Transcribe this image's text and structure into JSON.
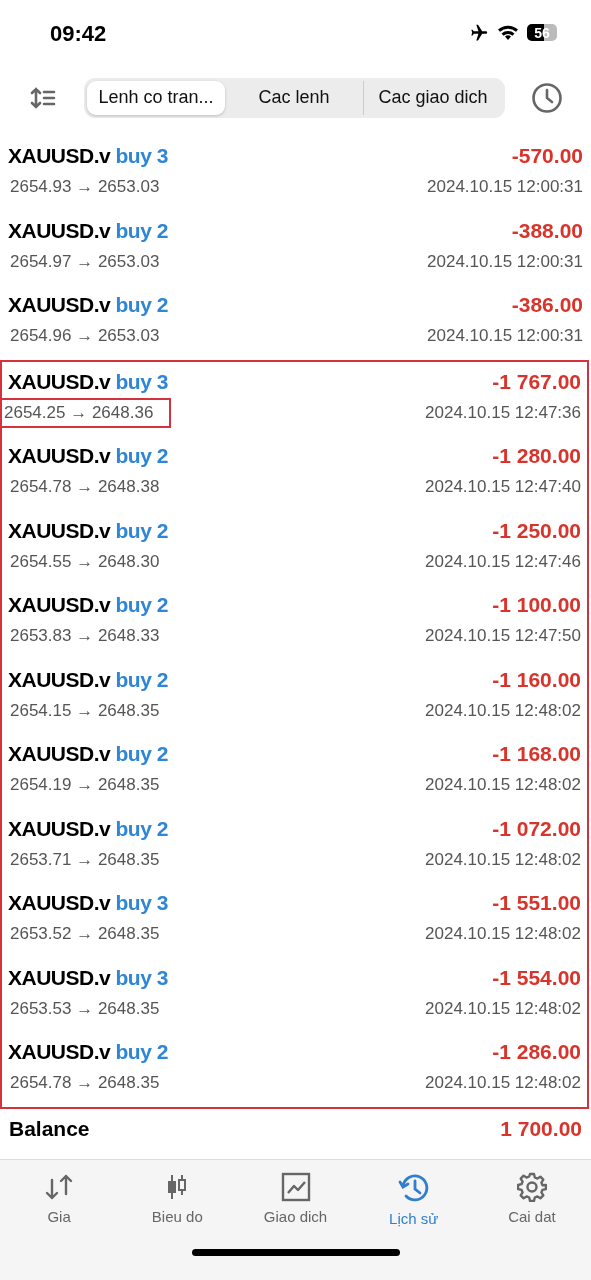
{
  "status_bar": {
    "time": "09:42",
    "airplane_mode": true,
    "battery_text": "56"
  },
  "segments": [
    {
      "label": "Lenh co tran...",
      "selected": true
    },
    {
      "label": "Cac lenh",
      "selected": false
    },
    {
      "label": "Cac giao dich",
      "selected": false
    }
  ],
  "groups": [
    {
      "highlighted": false,
      "trades": [
        {
          "symbol": "XAUUSD.v",
          "side": "buy 3",
          "profit": "-570.00",
          "prices": "2654.93 → 2653.03",
          "time": "2024.10.15 12:00:31",
          "price_boxed": false
        },
        {
          "symbol": "XAUUSD.v",
          "side": "buy 2",
          "profit": "-388.00",
          "prices": "2654.97 → 2653.03",
          "time": "2024.10.15 12:00:31",
          "price_boxed": false
        },
        {
          "symbol": "XAUUSD.v",
          "side": "buy 2",
          "profit": "-386.00",
          "prices": "2654.96 → 2653.03",
          "time": "2024.10.15 12:00:31",
          "price_boxed": false
        }
      ]
    },
    {
      "highlighted": true,
      "trades": [
        {
          "symbol": "XAUUSD.v",
          "side": "buy 3",
          "profit": "-1 767.00",
          "prices": "2654.25 → 2648.36",
          "time": "2024.10.15 12:47:36",
          "price_boxed": true
        },
        {
          "symbol": "XAUUSD.v",
          "side": "buy 2",
          "profit": "-1 280.00",
          "prices": "2654.78 → 2648.38",
          "time": "2024.10.15 12:47:40",
          "price_boxed": false
        },
        {
          "symbol": "XAUUSD.v",
          "side": "buy 2",
          "profit": "-1 250.00",
          "prices": "2654.55 → 2648.30",
          "time": "2024.10.15 12:47:46",
          "price_boxed": false
        },
        {
          "symbol": "XAUUSD.v",
          "side": "buy 2",
          "profit": "-1 100.00",
          "prices": "2653.83 → 2648.33",
          "time": "2024.10.15 12:47:50",
          "price_boxed": false
        },
        {
          "symbol": "XAUUSD.v",
          "side": "buy 2",
          "profit": "-1 160.00",
          "prices": "2654.15 → 2648.35",
          "time": "2024.10.15 12:48:02",
          "price_boxed": false
        },
        {
          "symbol": "XAUUSD.v",
          "side": "buy 2",
          "profit": "-1 168.00",
          "prices": "2654.19 → 2648.35",
          "time": "2024.10.15 12:48:02",
          "price_boxed": false
        },
        {
          "symbol": "XAUUSD.v",
          "side": "buy 2",
          "profit": "-1 072.00",
          "prices": "2653.71 → 2648.35",
          "time": "2024.10.15 12:48:02",
          "price_boxed": false
        },
        {
          "symbol": "XAUUSD.v",
          "side": "buy 3",
          "profit": "-1 551.00",
          "prices": "2653.52 → 2648.35",
          "time": "2024.10.15 12:48:02",
          "price_boxed": false
        },
        {
          "symbol": "XAUUSD.v",
          "side": "buy 3",
          "profit": "-1 554.00",
          "prices": "2653.53 → 2648.35",
          "time": "2024.10.15 12:48:02",
          "price_boxed": false
        },
        {
          "symbol": "XAUUSD.v",
          "side": "buy 2",
          "profit": "-1 286.00",
          "prices": "2654.78 → 2648.35",
          "time": "2024.10.15 12:48:02",
          "price_boxed": false
        }
      ]
    }
  ],
  "balance": {
    "label": "Balance",
    "value": "1 700.00"
  },
  "nav": [
    {
      "kind": "prices",
      "label": "Gia",
      "selected": false
    },
    {
      "kind": "chart",
      "label": "Bieu do",
      "selected": false
    },
    {
      "kind": "trade",
      "label": "Giao dich",
      "selected": false
    },
    {
      "kind": "history",
      "label": "Lịch sử",
      "selected": true
    },
    {
      "kind": "settings",
      "label": "Cai dat",
      "selected": false
    }
  ]
}
